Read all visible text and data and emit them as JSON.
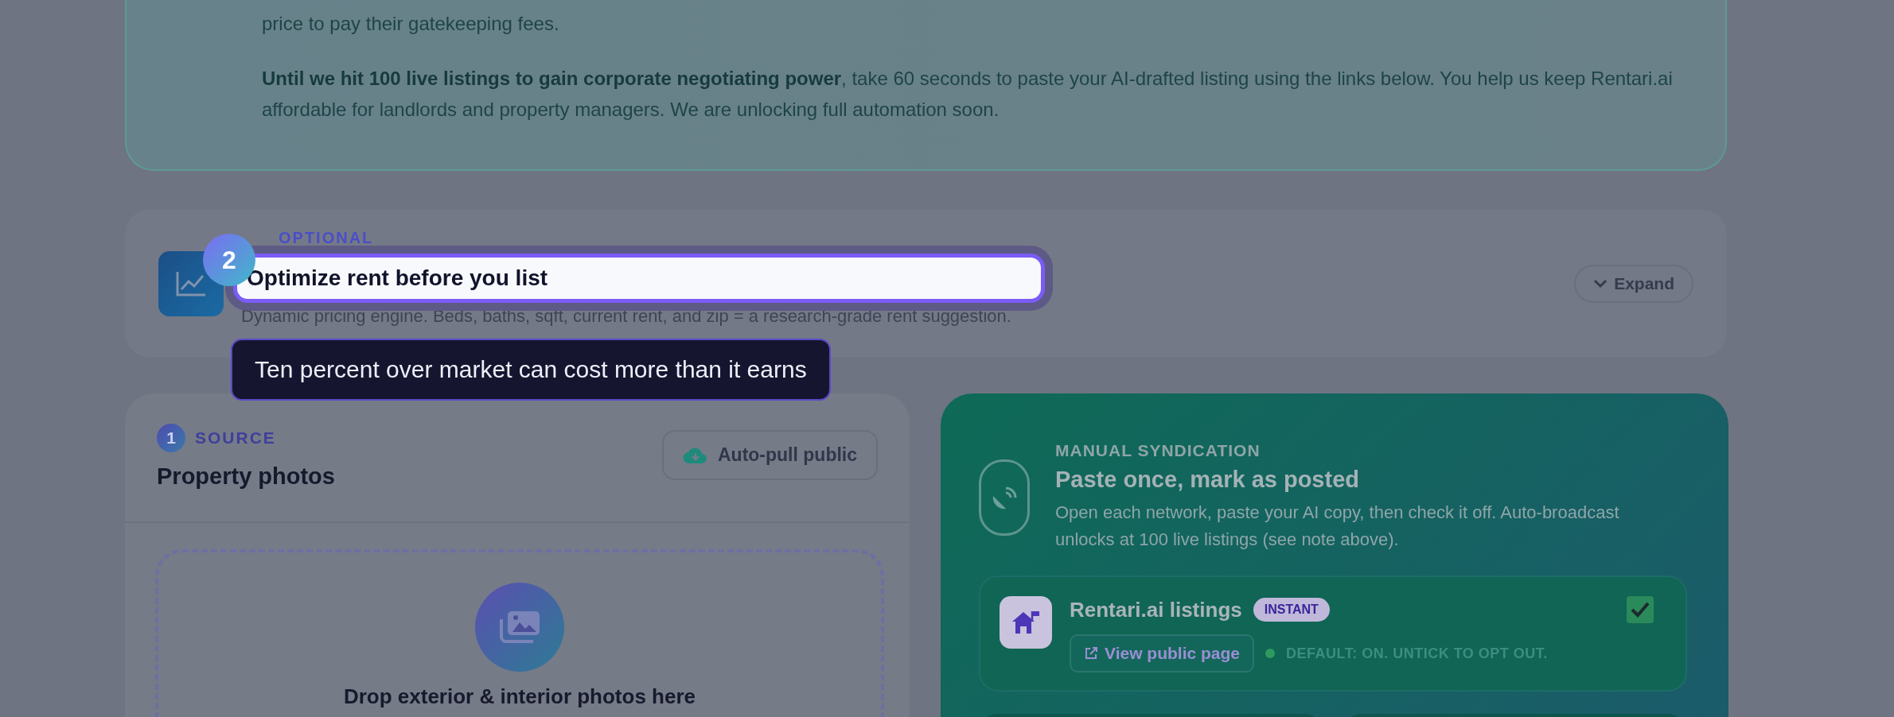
{
  "intro": {
    "paragraphs": [
      "price to pay their gatekeeping fees.",
      "**Until we hit 100 live listings to gain corporate negotiating power**, take 60 seconds to paste your AI-drafted listing using the links below. You help us keep Rentari.ai affordable for landlords and property managers. We are unlocking full automation soon."
    ]
  },
  "optional_step": {
    "label": "OPTIONAL",
    "title": "Optimize rent before you list",
    "description": "Dynamic pricing engine. Beds, baths, sqft, current rent, and zip = a research-grade rent suggestion.",
    "expand_button": "Expand",
    "expanded": false
  },
  "tour": {
    "step": "2",
    "tooltip": "Ten percent over market can cost more than it earns"
  },
  "source_card": {
    "step": "1",
    "label": "SOURCE",
    "title": "Property photos",
    "auto_pull_button": "Auto-pull public",
    "dropzone_text": "Drop exterior & interior photos here"
  },
  "syndication": {
    "label": "MANUAL SYNDICATION",
    "title": "Paste once, mark as posted",
    "description": "Open each network, paste your AI copy, then check it off. Auto-broadcast unlocks at 100 live listings (see note above).",
    "networks": [
      {
        "name": "Rentari.ai listings",
        "badge": "INSTANT",
        "link": "View public page",
        "note": "DEFAULT: ON. UNTICK TO OPT OUT.",
        "checked": true
      }
    ]
  }
}
